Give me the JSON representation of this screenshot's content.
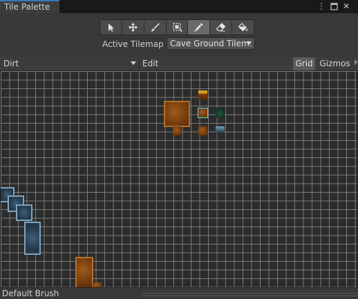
{
  "window": {
    "tab_title": "Tile Palette",
    "menu_icon": "more-vert-icon",
    "maximize_icon": "maximize-icon",
    "close_icon": "close-icon"
  },
  "toolbar": {
    "tools": [
      {
        "name": "select",
        "icon": "select-arrow-icon",
        "active": false
      },
      {
        "name": "move",
        "icon": "move-icon",
        "active": false
      },
      {
        "name": "paint",
        "icon": "brush-icon",
        "active": false
      },
      {
        "name": "box-fill",
        "icon": "box-fill-icon",
        "active": false
      },
      {
        "name": "pick",
        "icon": "eyedropper-icon",
        "active": true
      },
      {
        "name": "erase",
        "icon": "eraser-icon",
        "active": false
      },
      {
        "name": "flood-fill",
        "icon": "paint-bucket-icon",
        "active": false
      }
    ]
  },
  "active_tilemap": {
    "label": "Active Tilemap",
    "value": "Cave Ground Tilem:"
  },
  "palette_bar": {
    "palette_name": "Dirt",
    "edit_label": "Edit",
    "grid_label": "Grid",
    "gizmos_label": "Gizmos",
    "grid_active": true
  },
  "bottom_bar": {
    "brush_name": "Default Brush"
  },
  "colors": {
    "accent": "#3a79bb",
    "selection": "#58d8d8",
    "dirt": "#8a4b14",
    "grass": "#d8a12a",
    "moss": "#1c5e3c",
    "stone": "#6fa0b8",
    "water": "#7fa4bd"
  }
}
